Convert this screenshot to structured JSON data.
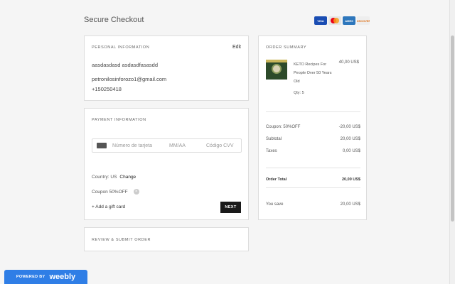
{
  "header": {
    "title": "Secure Checkout"
  },
  "payment_cards": [
    {
      "label": "VISA",
      "icon": "visa-card-icon",
      "color": "#1a4db3"
    },
    {
      "label": "",
      "icon": "mastercard-icon",
      "color": "#eb001b"
    },
    {
      "label": "AMEX",
      "icon": "amex-card-icon",
      "color": "#2e77bc"
    },
    {
      "label": "DISCOVER",
      "icon": "discover-card-icon",
      "color": "#e07016"
    }
  ],
  "personal": {
    "label": "PERSONAL INFORMATION",
    "edit": "Edit",
    "name": "aasdasdasd asdasdfasasdd",
    "email": "petronilosinforozo1@gmail.com",
    "phone": "+150250418"
  },
  "payment": {
    "label": "PAYMENT INFORMATION",
    "card_number_placeholder": "Número de tarjeta",
    "expiry_placeholder": "MM/AA",
    "cvv_placeholder": "Código CVV",
    "country": "Country: US",
    "change": "Change",
    "coupon": "Coupon 50%OFF",
    "remove_icon": "×",
    "gift": "+ Add a gift card",
    "next": "NEXT"
  },
  "review": {
    "label": "REVIEW & SUBMIT ORDER"
  },
  "summary": {
    "label": "ORDER SUMMARY",
    "product": {
      "name": "KETO Recipes For People Over 50 Years Old",
      "price": "40,00 US$",
      "qty": "Qty: 5"
    },
    "rows": [
      {
        "label": "Coupon: 50%OFF",
        "value": "-20,00 US$"
      },
      {
        "label": "Subtotal",
        "value": "20,00 US$"
      },
      {
        "label": "Taxes",
        "value": "0,00 US$"
      }
    ],
    "total": {
      "label": "Order Total",
      "value": "20,00 US$"
    },
    "save": {
      "label": "You save",
      "value": "20,00 US$"
    }
  },
  "footer": {
    "powered_by": "POWERED BY",
    "brand": "weebly",
    "brand_color": "#2f7ee6"
  }
}
